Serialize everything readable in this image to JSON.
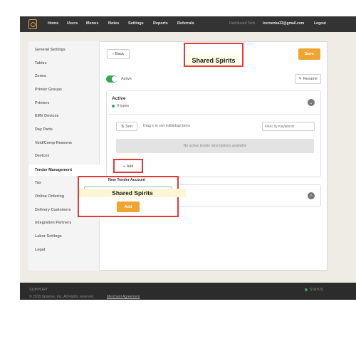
{
  "nav": {
    "items": [
      "Home",
      "Users",
      "Menus",
      "Notes",
      "Settings",
      "Reports",
      "Referrals"
    ],
    "dashboard_label": "Dashboard Tech",
    "email": "lcervenka33@gmail.com",
    "logout": "Logout"
  },
  "sidebar": {
    "items": [
      {
        "label": "General Settings"
      },
      {
        "label": "Tables"
      },
      {
        "label": "Zones"
      },
      {
        "label": "Printer Groups"
      },
      {
        "label": "Printers"
      },
      {
        "label": "EMV Devices"
      },
      {
        "label": "Day Parts"
      },
      {
        "label": "Void/Comp Reasons"
      },
      {
        "label": "Devices"
      },
      {
        "label": "Tender Management"
      },
      {
        "label": "Tax"
      },
      {
        "label": "Online Ordering"
      },
      {
        "label": "Delivery Customers"
      },
      {
        "label": "Integration Partners"
      },
      {
        "label": "Labor Settings"
      },
      {
        "label": "Legal"
      }
    ],
    "active_index": 9
  },
  "header": {
    "back_label": "Back",
    "save_label": "Save",
    "title_overlay": "Shared Spirits"
  },
  "status": {
    "active_label": "Active",
    "rename_label": "Rename"
  },
  "active_card": {
    "title": "Active",
    "count_label": "0 types",
    "sort_label": "Sort",
    "drag_text": "Drag ≡ to sort individual items",
    "filter_placeholder": "Filter by Keywords",
    "empty_text": "No active tender descriptions available",
    "add_label": "Add"
  },
  "popover": {
    "title": "New Tender Account",
    "input_value": "Shared Spirits",
    "add_label": "Add"
  },
  "footer": {
    "support": "SUPPORT",
    "copyright": "© 2018 Upserve, Inc. All Rights reserved.",
    "merchant_link": "Merchant Agreement",
    "status": "STATUS"
  },
  "colors": {
    "accent": "#f0a531",
    "active_green": "#34a853",
    "highlight_red": "#e53935"
  }
}
